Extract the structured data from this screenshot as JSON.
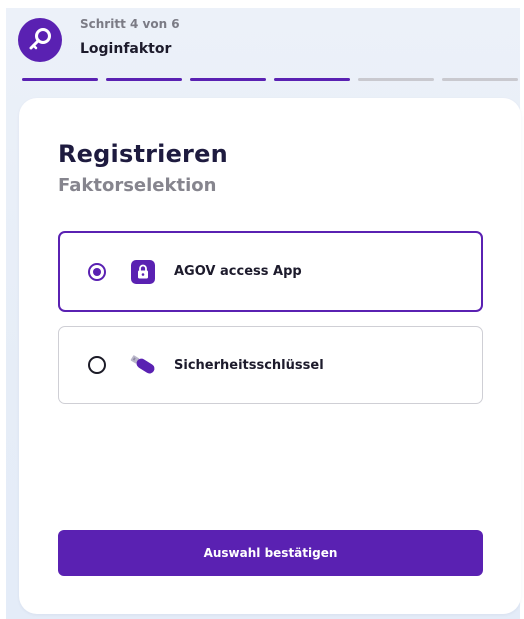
{
  "header": {
    "step_label": "Schritt 4 von 6",
    "step_title": "Loginfaktor",
    "icon": "key-icon"
  },
  "progress": {
    "total_steps": 6,
    "current_step": 4
  },
  "card": {
    "title": "Registrieren",
    "subtitle": "Faktorselektion",
    "options": [
      {
        "label": "AGOV access App",
        "icon": "lock-app-icon",
        "selected": true
      },
      {
        "label": "Sicherheitsschlüssel",
        "icon": "usb-key-icon",
        "selected": false
      }
    ],
    "confirm_label": "Auswahl bestätigen"
  },
  "colors": {
    "accent": "#5a21b2",
    "progress_inactive": "#c9c9cf",
    "title": "#1e1b3f",
    "subtitle": "#86858e",
    "background": "#e6edf7"
  }
}
